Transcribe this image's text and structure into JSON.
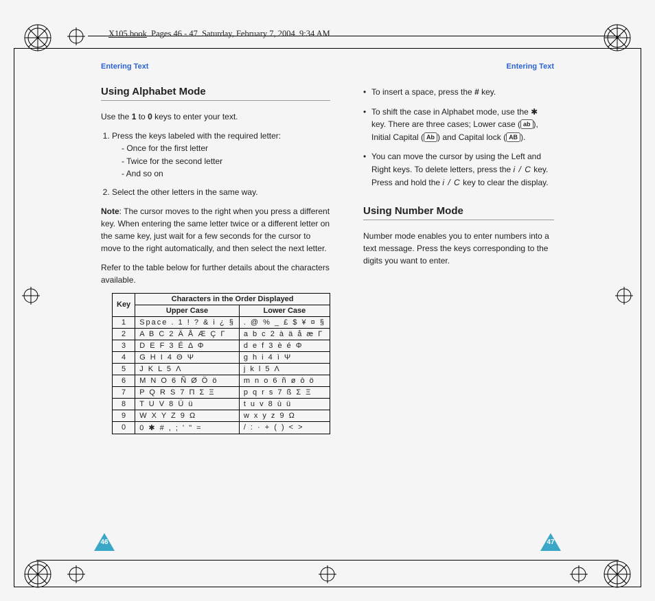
{
  "file_header": {
    "name": "X105.book",
    "pages": "Pages 46 - 47",
    "date": "Saturday, February 7, 2004",
    "time": "9:34 AM"
  },
  "left": {
    "running": "Entering Text",
    "h2": "Using Alphabet Mode",
    "intro_a": "Use the ",
    "intro_b": " to ",
    "intro_c": " keys to enter your text.",
    "intro_k1": "1",
    "intro_k0": "0",
    "step1": "Press the keys labeled with the required letter:",
    "step1a": "- Once for the first letter",
    "step1b": "- Twice for the second letter",
    "step1c": "- And so on",
    "step2": "Select the other letters in the same way.",
    "note_label": "Note",
    "note_body": ": The cursor moves to the right when you press a different key. When entering the same letter twice or a different letter on the same key, just wait for a few seconds for the cursor to move to the right automatically, and then select the next letter.",
    "table_intro": "Refer to the table below for further details about the characters available.",
    "th_key": "Key",
    "th_group": "Characters in the Order Displayed",
    "th_upper": "Upper Case",
    "th_lower": "Lower Case",
    "rows": [
      {
        "k": "1",
        "u": "Space . 1 ! ? & i ¿ §",
        "l": ". @ % _ £ $ ¥ ¤ §"
      },
      {
        "k": "2",
        "u": "A B C 2 Ä Å Æ Ç Γ",
        "l": "a b c 2 à ä å æ Γ"
      },
      {
        "k": "3",
        "u": "D E F 3 É Δ Φ",
        "l": "d e f 3 è é Φ"
      },
      {
        "k": "4",
        "u": "G H I 4 Θ Ψ",
        "l": "g h i 4 ì Ψ"
      },
      {
        "k": "5",
        "u": "J K L 5 Λ",
        "l": "j k l 5 Λ"
      },
      {
        "k": "6",
        "u": "M N O 6 Ñ Ø Ö ö",
        "l": "m n o 6 ñ ø ò ö"
      },
      {
        "k": "7",
        "u": "P Q R S 7 Π Σ Ξ",
        "l": "p q r s 7 ß Σ Ξ"
      },
      {
        "k": "8",
        "u": "T U V 8 Ü ü",
        "l": "t u v 8 ù ü"
      },
      {
        "k": "9",
        "u": "W X Y Z 9 Ω",
        "l": "w x y z 9 Ω"
      },
      {
        "k": "0",
        "u": "0 ✱ # , ; ' \" =",
        "l": "/ : · + ( ) < >"
      }
    ],
    "pagenum": "46"
  },
  "right": {
    "running": "Entering Text",
    "b1a": "To insert a space, press the ",
    "b1b": " key.",
    "b1_icon": "#",
    "b2a": "To shift the case in Alphabet mode, use the ",
    "b2b": " key. There are three cases; Lower case (",
    "b2c": "), Initial Capital (",
    "b2d": ") and Capital lock (",
    "b2e": ").",
    "b2_star": "✱",
    "b2_ab": "ab",
    "b2_Ab": "Ab",
    "b2_AB": "AB",
    "b3a": "You can move the cursor by using the Left and Right keys. To delete letters, press the ",
    "b3b": " key. Press and hold the ",
    "b3c": " key to clear the display.",
    "b3_ic": "i / C",
    "h2": "Using Number Mode",
    "p": "Number mode enables you to enter numbers into a text message. Press the keys corresponding to the digits you want to enter.",
    "pagenum": "47"
  }
}
